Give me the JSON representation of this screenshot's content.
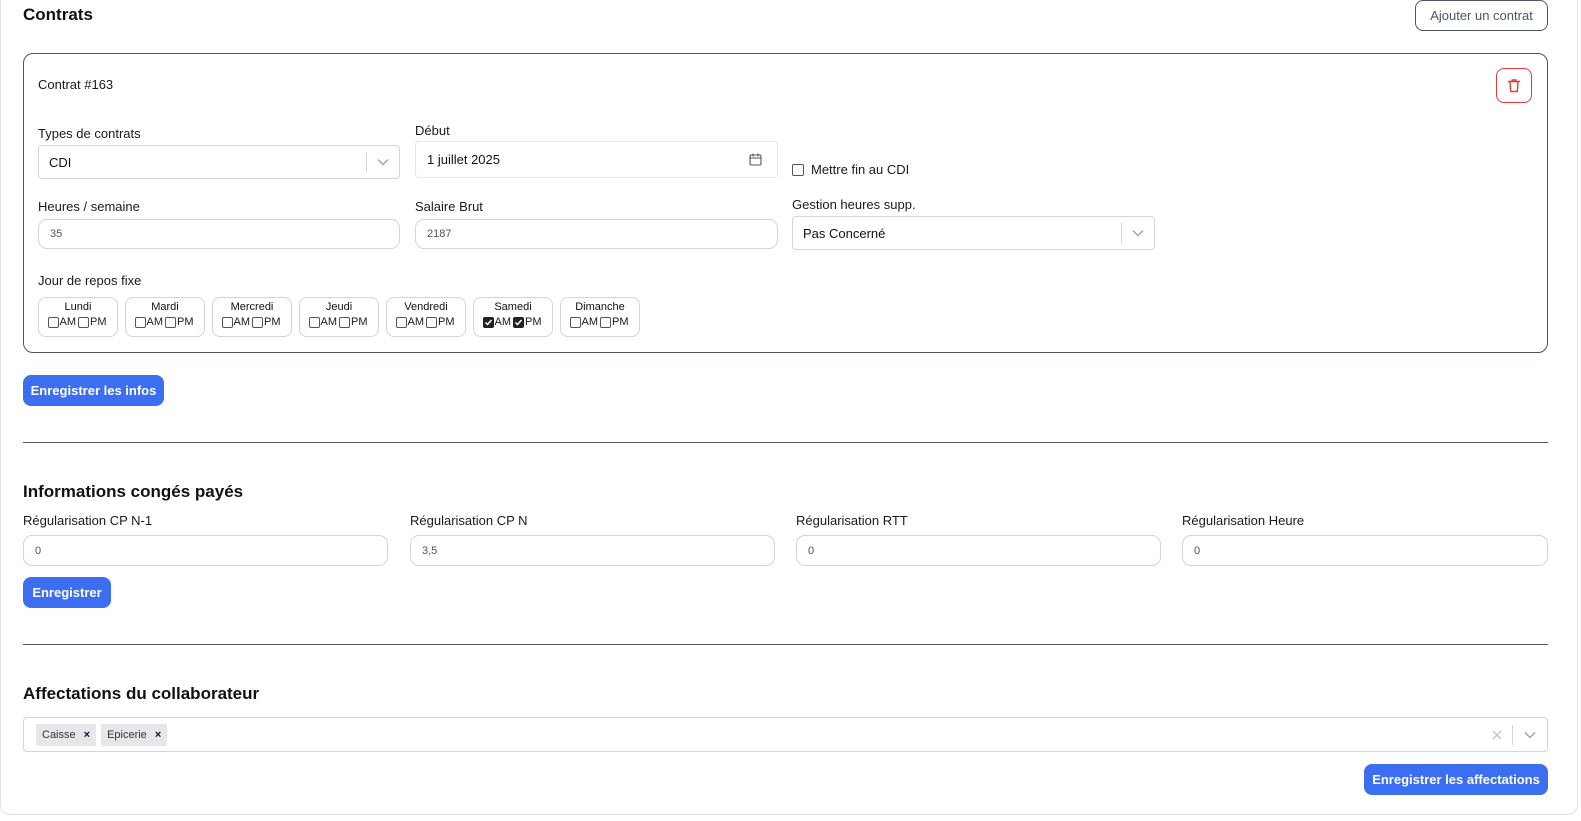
{
  "contracts": {
    "title": "Contrats",
    "add_button": "Ajouter un contrat",
    "card": {
      "title": "Contrat #163",
      "type_label": "Types de contrats",
      "type_value": "CDI",
      "start_label": "Début",
      "start_value": "1 juillet 2025",
      "end_cdi_label": "Mettre fin au CDI",
      "hours_label": "Heures / semaine",
      "hours_value": "35",
      "salary_label": "Salaire Brut",
      "salary_value": "2187",
      "overtime_label": "Gestion heures supp.",
      "overtime_value": "Pas Concerné",
      "rest_label": "Jour de repos fixe",
      "days": [
        {
          "name": "Lundi",
          "am": false,
          "pm": false
        },
        {
          "name": "Mardi",
          "am": false,
          "pm": false
        },
        {
          "name": "Mercredi",
          "am": false,
          "pm": false
        },
        {
          "name": "Jeudi",
          "am": false,
          "pm": false
        },
        {
          "name": "Vendredi",
          "am": false,
          "pm": false
        },
        {
          "name": "Samedi",
          "am": true,
          "pm": true
        },
        {
          "name": "Dimanche",
          "am": false,
          "pm": false
        }
      ],
      "am_label": "AM",
      "pm_label": "PM"
    },
    "save_button": "Enregistrer les infos"
  },
  "leave": {
    "title": "Informations congés payés",
    "fields": [
      {
        "label": "Régularisation CP N-1",
        "value": "0"
      },
      {
        "label": "Régularisation CP N",
        "value": "3,5"
      },
      {
        "label": "Régularisation RTT",
        "value": "0"
      },
      {
        "label": "Régularisation Heure",
        "value": "0"
      }
    ],
    "save_button": "Enregistrer"
  },
  "assignments": {
    "title": "Affectations du collaborateur",
    "tags": [
      "Caisse",
      "Epicerie"
    ],
    "save_button": "Enregistrer les affectations"
  },
  "colors": {
    "primary": "#3b6ef0",
    "danger": "#e53935",
    "border_dark": "#4b5563"
  }
}
